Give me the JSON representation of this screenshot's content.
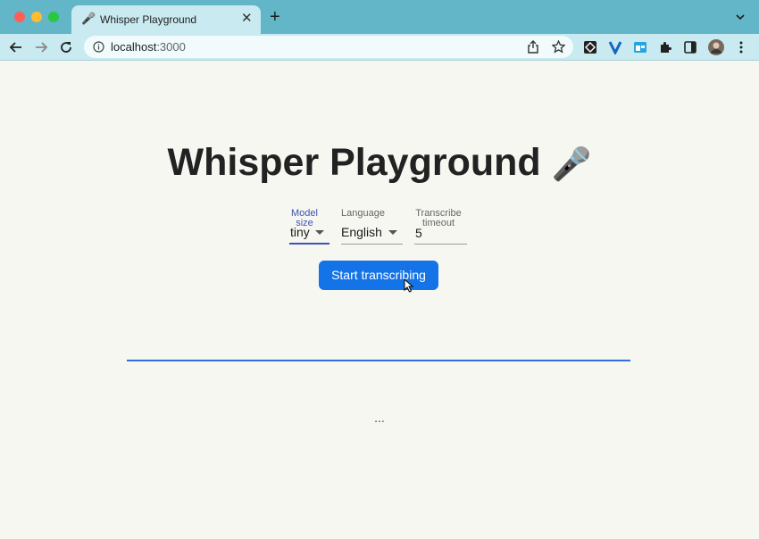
{
  "browser": {
    "tab": {
      "icon": "microphone-icon",
      "title": "Whisper Playground",
      "close": "✕"
    },
    "new_tab": "+",
    "url_host": "localhost",
    "url_port": ":3000"
  },
  "page": {
    "title": "Whisper Playground",
    "title_icon": "microphone-icon",
    "model_size": {
      "label_line1": "Model",
      "label_line2": "size",
      "value": "tiny"
    },
    "language": {
      "label": "Language",
      "value": "English"
    },
    "timeout": {
      "label_line1": "Transcribe",
      "label_line2": "timeout",
      "value": "5"
    },
    "start_button": "Start transcribing",
    "progress": 1.0,
    "output": "..."
  },
  "colors": {
    "accent": "#1473e6",
    "active_field": "#3f51b5",
    "progress": "#2f6fe0",
    "tabbar": "#62b6c8"
  }
}
